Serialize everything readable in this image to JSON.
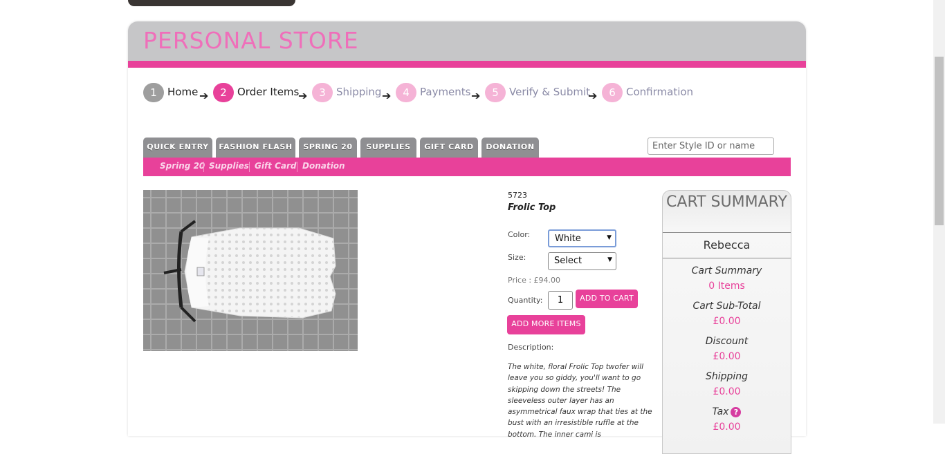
{
  "store": {
    "title": "PERSONAL STORE"
  },
  "steps": [
    {
      "num": "1",
      "label": "Home",
      "state": "done"
    },
    {
      "num": "2",
      "label": "Order Items",
      "state": "active"
    },
    {
      "num": "3",
      "label": "Shipping",
      "state": "todo"
    },
    {
      "num": "4",
      "label": "Payments",
      "state": "todo"
    },
    {
      "num": "5",
      "label": "Verify & Submit",
      "state": "todo"
    },
    {
      "num": "6",
      "label": "Confirmation",
      "state": "todo"
    }
  ],
  "tabs": [
    "QUICK ENTRY",
    "FASHION FLASH",
    "SPRING 20",
    "SUPPLIES",
    "GIFT CARD",
    "DONATION"
  ],
  "search": {
    "placeholder": "Enter Style ID or name"
  },
  "subnav": [
    "Spring 20",
    "Supplies",
    "Gift Card",
    "Donation"
  ],
  "product": {
    "id": "5723",
    "name": "Frolic Top",
    "color_label": "Color:",
    "color_value": "White",
    "size_label": "Size:",
    "size_value": "Select",
    "price": "Price : £94.00",
    "quantity_label": "Quantity:",
    "quantity_value": "1",
    "add_to_cart": "ADD TO CART",
    "add_more": "ADD MORE ITEMS",
    "description_label": "Description:",
    "description": "The white, floral Frolic Top twofer will leave you so giddy, you'll want to go skipping down the streets! The sleeveless outer layer has an asymmetrical faux wrap that ties at the bust with an irresistible ruffle at the bottom. The inner cami is"
  },
  "cart": {
    "title": "CART SUMMARY",
    "user": "Rebecca",
    "summary_label": "Cart Summary",
    "items": "0 Items",
    "subtotal_label": "Cart Sub-Total",
    "subtotal": "£0.00",
    "discount_label": "Discount",
    "discount": "£0.00",
    "shipping_label": "Shipping",
    "shipping": "£0.00",
    "tax_label": "Tax",
    "tax_help": "?",
    "tax": "£0.00"
  },
  "colors": {
    "accent": "#e8419a",
    "title_pink": "#ef6fba",
    "tab_gray": "#8f8f92",
    "header_gray": "#c6c6c8"
  },
  "icons": {
    "step_arrow": "arrow-right-icon",
    "help": "help-icon",
    "select_caret": "caret-down-icon"
  }
}
